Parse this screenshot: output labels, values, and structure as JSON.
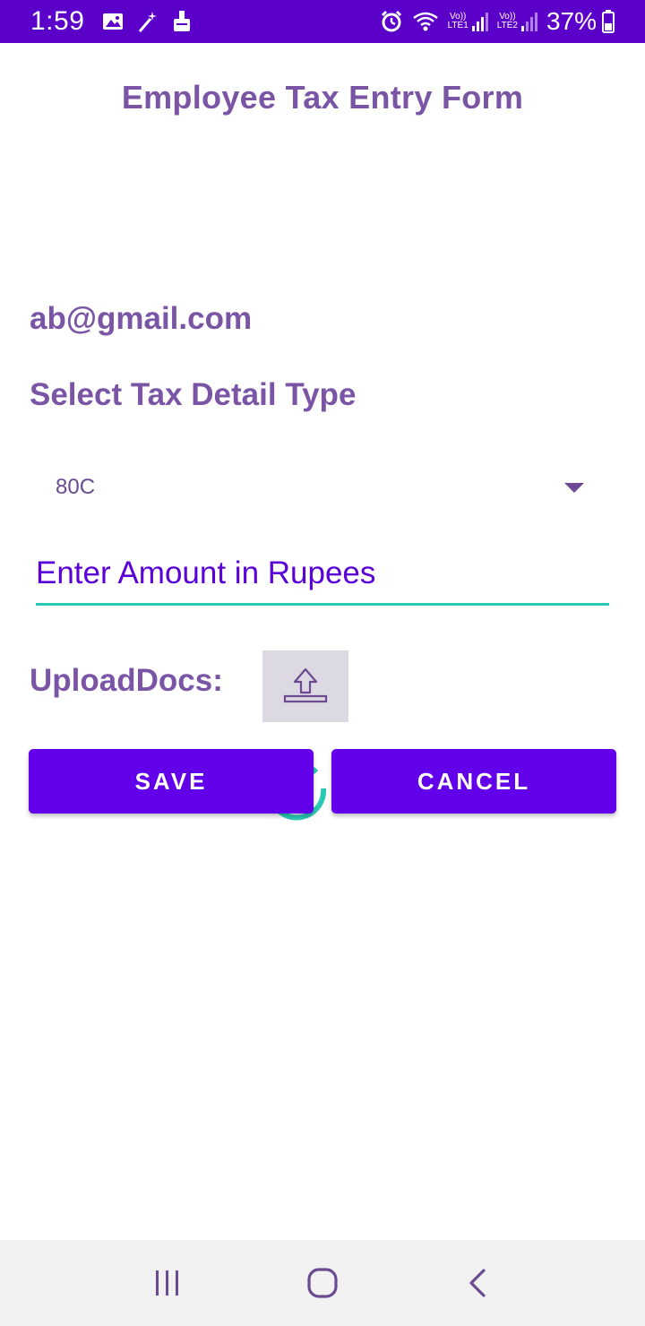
{
  "status_bar": {
    "time": "1:59",
    "network1_top": "Vo))",
    "network1_bottom": "LTE1",
    "network2_top": "Vo))",
    "network2_bottom": "LTE2",
    "battery_percent": "37%",
    "icons": [
      "gallery-icon",
      "magic-wand-icon",
      "cleaner-icon",
      "alarm-icon",
      "wifi-icon",
      "signal-icon",
      "battery-icon"
    ]
  },
  "form": {
    "title": "Employee Tax Entry Form",
    "email": "ab@gmail.com",
    "select_label": "Select Tax Detail Type",
    "tax_type": {
      "selected": "80C"
    },
    "amount": {
      "value": "",
      "placeholder": "Enter Amount in Rupees"
    },
    "upload_label": "UploadDocs:",
    "save_label": "SAVE",
    "cancel_label": "CANCEL"
  },
  "colors": {
    "status_bar": "#5b00c9",
    "primary_button": "#6200ea",
    "label_text": "#7a55a6",
    "accent": "#2bc9b4"
  },
  "nav_bar": {
    "icons": [
      "recent-apps-icon",
      "home-icon",
      "back-icon"
    ]
  }
}
